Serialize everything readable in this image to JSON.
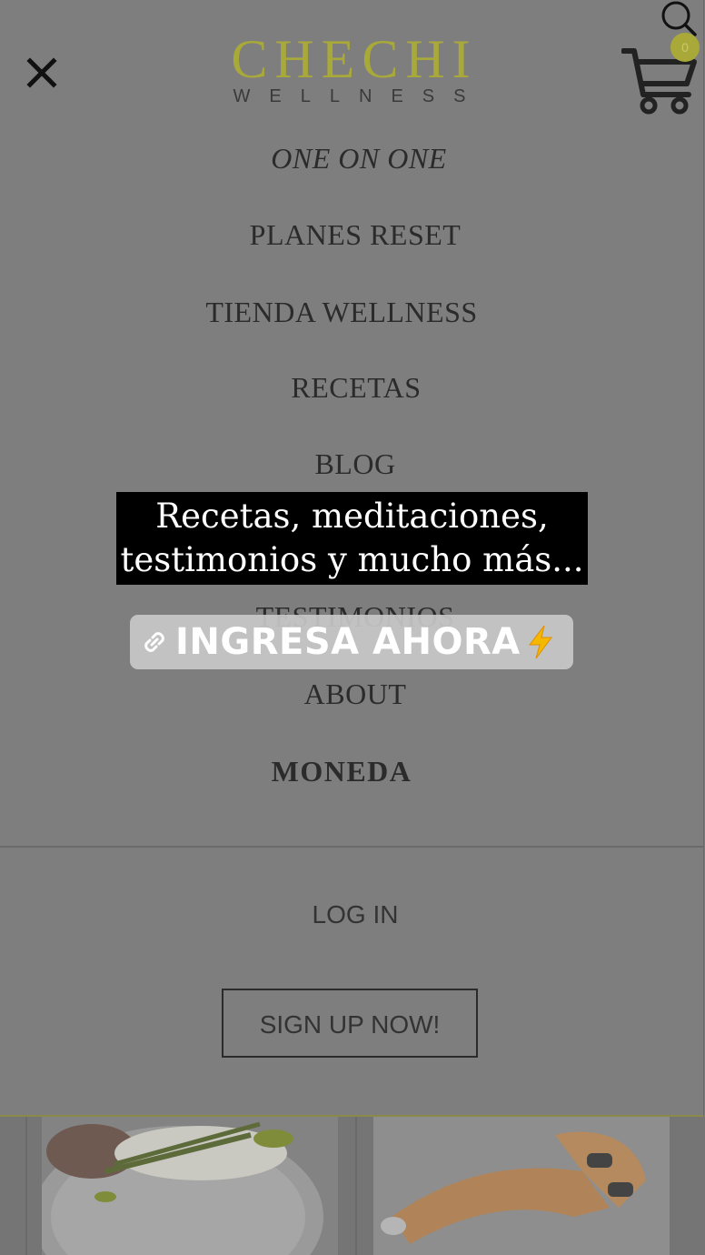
{
  "brand": {
    "name": "CHECHI",
    "tagline": "WELLNESS"
  },
  "cart": {
    "count": "0"
  },
  "nav": {
    "items": [
      {
        "label": "ONE ON ONE"
      },
      {
        "label": "PLANES RESET"
      },
      {
        "label": "TIENDA WELLNESS"
      },
      {
        "label": "RECETAS"
      },
      {
        "label": "BLOG"
      },
      {
        "label": "TESTIMONIOS"
      },
      {
        "label": "ABOUT"
      },
      {
        "label": "MONEDA"
      }
    ]
  },
  "auth": {
    "login_label": "LOG IN",
    "signup_label": "SIGN UP NOW!"
  },
  "story": {
    "caption_line1": "Recetas, meditaciones,",
    "caption_line2": "testimonios y mucho más...",
    "link_label": "INGRESA AHORA"
  },
  "colors": {
    "brand_olive": "#a9a93a",
    "overlay_gray": "#7e7e7e",
    "caption_bg": "#000000"
  },
  "icons": [
    "close-icon",
    "search-icon",
    "cart-icon",
    "link-icon",
    "bolt-icon"
  ]
}
